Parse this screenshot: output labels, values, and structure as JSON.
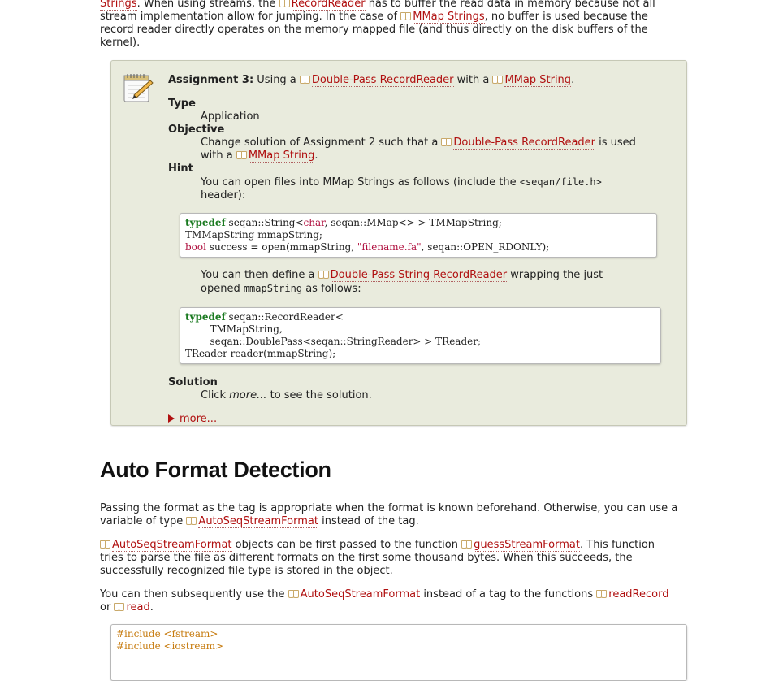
{
  "intro": {
    "l1_link": "Strings",
    "l1_a": ". When using streams, the ",
    "l1_link2": "RecordReader",
    "l1_b": " has to buffer the read data in memory because not all",
    "l2": "stream implementation allow for jumping. In the case of ",
    "l2_link": "MMap Strings",
    "l2_b": ", no buffer is used because the",
    "l3": "record reader directly operates on the memory mapped file (and thus directly on the disk buffers of the",
    "l4": "kernel)."
  },
  "assignment": {
    "title": "Assignment 3:",
    "using": " Using a ",
    "link_drr": "Double-Pass RecordReader",
    "with": " with a ",
    "link_mmap": "MMap String",
    "end": ".",
    "type_label": "Type",
    "type_value": "Application",
    "objective_label": "Objective",
    "objective_a": "Change solution of Assignment 2 such that a ",
    "objective_link": "Double-Pass RecordReader",
    "objective_b": " is used",
    "objective_c": "with a ",
    "objective_link2": "MMap String",
    "objective_d": ".",
    "hint_label": "Hint",
    "hint_a": "You can open files into MMap Strings as follows (include the ",
    "hint_code": "<seqan/file.h>",
    "hint_b": "header):",
    "code1": {
      "l1_kw": "typedef",
      "l1_a": " seqan::String<",
      "l1_ty": "char",
      "l1_b": ", seqan::MMap<> > TMMapString;",
      "l2": "TMMapString mmapString;",
      "l3_ty": "bool",
      "l3_a": " success = open(mmapString, ",
      "l3_st": "\"filename.fa\"",
      "l3_b": ", seqan::OPEN_RDONLY);"
    },
    "then_a": "You can then define a ",
    "then_link": "Double-Pass String RecordReader",
    "then_b": " wrapping the just",
    "then_c": "opened ",
    "then_code": "mmapString",
    "then_d": " as follows:",
    "code2": {
      "l1_kw": "typedef",
      "l1_a": " seqan::RecordReader<",
      "l2": "        TMMapString,",
      "l3": "        seqan::DoublePass<seqan::StringReader> > TReader;",
      "l4": "TReader reader(mmapString);"
    },
    "solution_label": "Solution",
    "solution_a": "Click ",
    "solution_em": "more...",
    "solution_b": " to see the solution.",
    "more_label": "more..."
  },
  "section": {
    "title": "Auto Format Detection",
    "p1_a": "Passing the format as the tag is appropriate when the format is known beforehand. Otherwise, you can use a",
    "p1_b": "variable of type ",
    "p1_link": "AutoSeqStreamFormat",
    "p1_c": " instead of the tag.",
    "p2_link": "AutoSeqStreamFormat",
    "p2_a": " objects can be first passed to the function ",
    "p2_link2": "guessStreamFormat",
    "p2_b": ". This function",
    "p2_c": "tries to parse the file as different formats on the first some thousand bytes. When this succeeds, the",
    "p2_d": "successfully recognized file type is stored in the object.",
    "p3_a": "You can then subsequently use the ",
    "p3_link": "AutoSeqStreamFormat",
    "p3_b": " instead of a tag to the functions ",
    "p3_link2": "readRecord",
    "p3_c": "or ",
    "p3_link3": "read",
    "p3_d": ".",
    "code3": {
      "l1": "#include <fstream>",
      "l2": "#include <iostream>"
    }
  }
}
